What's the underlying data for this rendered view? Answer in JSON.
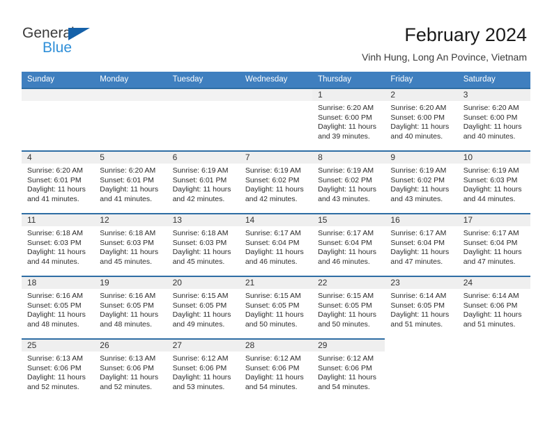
{
  "logo": {
    "word_top": "General",
    "word_bottom": "Blue",
    "triangle_color": "#1561a9",
    "blue_color": "#2f8fd8"
  },
  "header": {
    "title": "February 2024",
    "subtitle": "Vinh Hung, Long An Povince, Vietnam"
  },
  "theme": {
    "header_bar": "#3f7fbf",
    "day_band": "#efefef",
    "row_rule": "#2e6da4",
    "text": "#2b2b2b"
  },
  "weekdays": [
    "Sunday",
    "Monday",
    "Tuesday",
    "Wednesday",
    "Thursday",
    "Friday",
    "Saturday"
  ],
  "labels": {
    "sunrise": "Sunrise:",
    "sunset": "Sunset:",
    "daylight": "Daylight:"
  },
  "weeks": [
    [
      {
        "day": "",
        "blank": true
      },
      {
        "day": "",
        "blank": true
      },
      {
        "day": "",
        "blank": true
      },
      {
        "day": "",
        "blank": true
      },
      {
        "day": "1",
        "sunrise": "Sunrise: 6:20 AM",
        "sunset": "Sunset: 6:00 PM",
        "daylight": "Daylight: 11 hours and 39 minutes."
      },
      {
        "day": "2",
        "sunrise": "Sunrise: 6:20 AM",
        "sunset": "Sunset: 6:00 PM",
        "daylight": "Daylight: 11 hours and 40 minutes."
      },
      {
        "day": "3",
        "sunrise": "Sunrise: 6:20 AM",
        "sunset": "Sunset: 6:00 PM",
        "daylight": "Daylight: 11 hours and 40 minutes."
      }
    ],
    [
      {
        "day": "4",
        "sunrise": "Sunrise: 6:20 AM",
        "sunset": "Sunset: 6:01 PM",
        "daylight": "Daylight: 11 hours and 41 minutes."
      },
      {
        "day": "5",
        "sunrise": "Sunrise: 6:20 AM",
        "sunset": "Sunset: 6:01 PM",
        "daylight": "Daylight: 11 hours and 41 minutes."
      },
      {
        "day": "6",
        "sunrise": "Sunrise: 6:19 AM",
        "sunset": "Sunset: 6:01 PM",
        "daylight": "Daylight: 11 hours and 42 minutes."
      },
      {
        "day": "7",
        "sunrise": "Sunrise: 6:19 AM",
        "sunset": "Sunset: 6:02 PM",
        "daylight": "Daylight: 11 hours and 42 minutes."
      },
      {
        "day": "8",
        "sunrise": "Sunrise: 6:19 AM",
        "sunset": "Sunset: 6:02 PM",
        "daylight": "Daylight: 11 hours and 43 minutes."
      },
      {
        "day": "9",
        "sunrise": "Sunrise: 6:19 AM",
        "sunset": "Sunset: 6:02 PM",
        "daylight": "Daylight: 11 hours and 43 minutes."
      },
      {
        "day": "10",
        "sunrise": "Sunrise: 6:19 AM",
        "sunset": "Sunset: 6:03 PM",
        "daylight": "Daylight: 11 hours and 44 minutes."
      }
    ],
    [
      {
        "day": "11",
        "sunrise": "Sunrise: 6:18 AM",
        "sunset": "Sunset: 6:03 PM",
        "daylight": "Daylight: 11 hours and 44 minutes."
      },
      {
        "day": "12",
        "sunrise": "Sunrise: 6:18 AM",
        "sunset": "Sunset: 6:03 PM",
        "daylight": "Daylight: 11 hours and 45 minutes."
      },
      {
        "day": "13",
        "sunrise": "Sunrise: 6:18 AM",
        "sunset": "Sunset: 6:03 PM",
        "daylight": "Daylight: 11 hours and 45 minutes."
      },
      {
        "day": "14",
        "sunrise": "Sunrise: 6:17 AM",
        "sunset": "Sunset: 6:04 PM",
        "daylight": "Daylight: 11 hours and 46 minutes."
      },
      {
        "day": "15",
        "sunrise": "Sunrise: 6:17 AM",
        "sunset": "Sunset: 6:04 PM",
        "daylight": "Daylight: 11 hours and 46 minutes."
      },
      {
        "day": "16",
        "sunrise": "Sunrise: 6:17 AM",
        "sunset": "Sunset: 6:04 PM",
        "daylight": "Daylight: 11 hours and 47 minutes."
      },
      {
        "day": "17",
        "sunrise": "Sunrise: 6:17 AM",
        "sunset": "Sunset: 6:04 PM",
        "daylight": "Daylight: 11 hours and 47 minutes."
      }
    ],
    [
      {
        "day": "18",
        "sunrise": "Sunrise: 6:16 AM",
        "sunset": "Sunset: 6:05 PM",
        "daylight": "Daylight: 11 hours and 48 minutes."
      },
      {
        "day": "19",
        "sunrise": "Sunrise: 6:16 AM",
        "sunset": "Sunset: 6:05 PM",
        "daylight": "Daylight: 11 hours and 48 minutes."
      },
      {
        "day": "20",
        "sunrise": "Sunrise: 6:15 AM",
        "sunset": "Sunset: 6:05 PM",
        "daylight": "Daylight: 11 hours and 49 minutes."
      },
      {
        "day": "21",
        "sunrise": "Sunrise: 6:15 AM",
        "sunset": "Sunset: 6:05 PM",
        "daylight": "Daylight: 11 hours and 50 minutes."
      },
      {
        "day": "22",
        "sunrise": "Sunrise: 6:15 AM",
        "sunset": "Sunset: 6:05 PM",
        "daylight": "Daylight: 11 hours and 50 minutes."
      },
      {
        "day": "23",
        "sunrise": "Sunrise: 6:14 AM",
        "sunset": "Sunset: 6:05 PM",
        "daylight": "Daylight: 11 hours and 51 minutes."
      },
      {
        "day": "24",
        "sunrise": "Sunrise: 6:14 AM",
        "sunset": "Sunset: 6:06 PM",
        "daylight": "Daylight: 11 hours and 51 minutes."
      }
    ],
    [
      {
        "day": "25",
        "sunrise": "Sunrise: 6:13 AM",
        "sunset": "Sunset: 6:06 PM",
        "daylight": "Daylight: 11 hours and 52 minutes."
      },
      {
        "day": "26",
        "sunrise": "Sunrise: 6:13 AM",
        "sunset": "Sunset: 6:06 PM",
        "daylight": "Daylight: 11 hours and 52 minutes."
      },
      {
        "day": "27",
        "sunrise": "Sunrise: 6:12 AM",
        "sunset": "Sunset: 6:06 PM",
        "daylight": "Daylight: 11 hours and 53 minutes."
      },
      {
        "day": "28",
        "sunrise": "Sunrise: 6:12 AM",
        "sunset": "Sunset: 6:06 PM",
        "daylight": "Daylight: 11 hours and 54 minutes."
      },
      {
        "day": "29",
        "sunrise": "Sunrise: 6:12 AM",
        "sunset": "Sunset: 6:06 PM",
        "daylight": "Daylight: 11 hours and 54 minutes."
      },
      {
        "day": "",
        "blank": true,
        "tail": true
      },
      {
        "day": "",
        "blank": true,
        "tail": true
      }
    ]
  ]
}
